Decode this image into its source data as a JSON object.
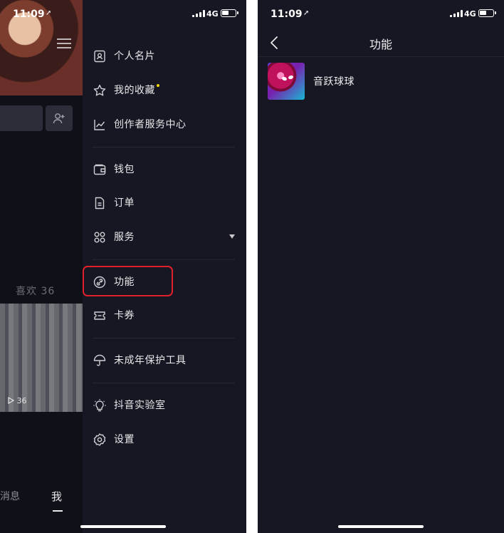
{
  "status_bar": {
    "time": "11:09",
    "network": "4G"
  },
  "left_screen": {
    "background": {
      "likes_label": "喜欢 36",
      "video_play_count": "36",
      "tab_messages": "消息",
      "tab_me": "我"
    },
    "drawer": {
      "items": [
        {
          "label": "个人名片",
          "icon": "contact-card-icon"
        },
        {
          "label": "我的收藏",
          "icon": "star-icon",
          "badge_dot": true
        },
        {
          "label": "创作者服务中心",
          "icon": "trend-chart-icon"
        },
        {
          "label": "钱包",
          "icon": "wallet-icon"
        },
        {
          "label": "订单",
          "icon": "document-icon"
        },
        {
          "label": "服务",
          "icon": "grid-icon",
          "expandable": true
        },
        {
          "label": "功能",
          "icon": "link-icon",
          "highlighted": true
        },
        {
          "label": "卡券",
          "icon": "ticket-icon"
        },
        {
          "label": "未成年保护工具",
          "icon": "umbrella-icon"
        },
        {
          "label": "抖音实验室",
          "icon": "lightbulb-icon"
        },
        {
          "label": "设置",
          "icon": "gear-icon"
        }
      ],
      "badge_color": "#f5d700",
      "highlight_color": "#e0212b"
    }
  },
  "right_screen": {
    "title": "功能",
    "features": [
      {
        "label": "音跃球球",
        "icon": "game-ball-icon"
      }
    ]
  },
  "colors": {
    "background": "#161722",
    "text": "#e8e8ea"
  }
}
